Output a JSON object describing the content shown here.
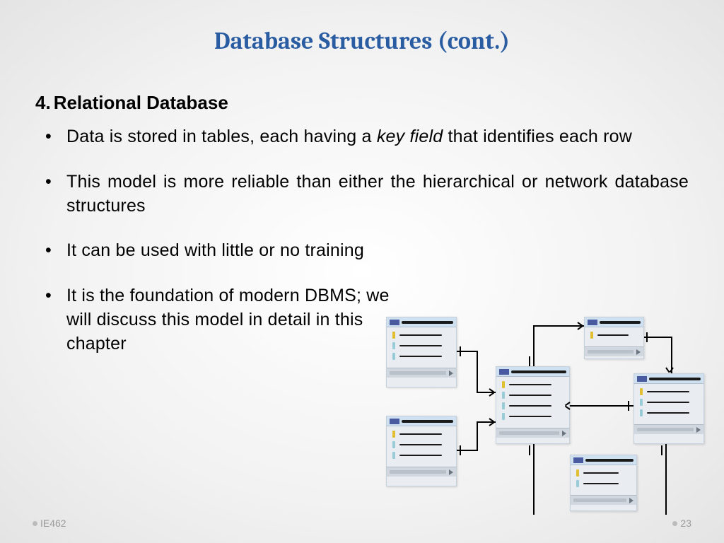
{
  "title": "Database Structures (cont.)",
  "heading_number": "4.",
  "heading_text": "Relational Database",
  "bullets": {
    "b1_pre": "Data is stored in tables, each having a ",
    "b1_em": "key field",
    "b1_post": " that identifies each row",
    "b2": "This model is more reliable than either the hierarchical or network database structures",
    "b3": "It can be used with little or no training",
    "b4": "It is the foundation of modern DBMS; we will discuss this model in detail in this chapter"
  },
  "footer": {
    "course": "IE462",
    "page": "23"
  }
}
